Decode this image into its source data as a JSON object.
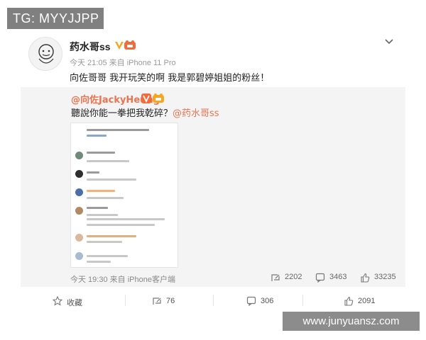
{
  "watermark_top": "TG: MYYJJPP",
  "post": {
    "username": "药水哥ss",
    "meta": "今天 21:05 来自 iPhone 11 Pro",
    "text": "向佐哥哥 我开玩笑的啊 我是郭碧婷姐姐的粉丝！"
  },
  "repost": {
    "author": "@向佐JackyHeung",
    "text": "聽說你能一拳把我乾碎？",
    "mention": "@药水哥ss",
    "meta": "今天 19:30 来自 iPhone客户端",
    "stats": {
      "reposts": "2202",
      "comments": "3463",
      "likes": "33235"
    }
  },
  "actions": {
    "favorite": "收藏",
    "repost": "76",
    "comment": "306",
    "like": "2091"
  },
  "watermark_site": "www.junyuansz.com",
  "colors": {
    "accent": "#eb7350",
    "vip": "#f5a623",
    "repost_bg": "#f4f4f4"
  },
  "icons": [
    "chevron-down-icon",
    "verified-v-icon",
    "vip-badge-icon",
    "repost-icon",
    "comment-icon",
    "like-icon",
    "star-icon"
  ]
}
